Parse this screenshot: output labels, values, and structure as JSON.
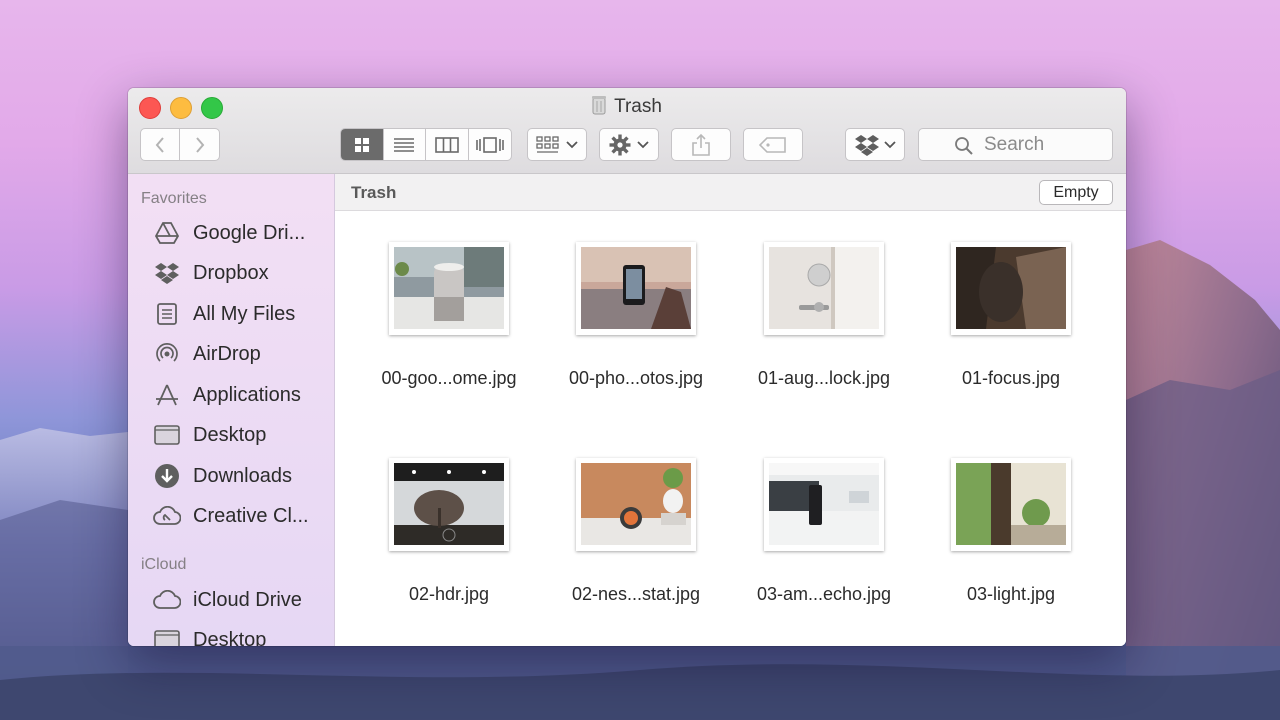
{
  "window": {
    "title": "Trash"
  },
  "toolbar": {
    "back_icon": "chevron-left-icon",
    "forward_icon": "chevron-right-icon",
    "view_modes": [
      "icon-view",
      "list-view",
      "column-view",
      "cover-flow-view"
    ],
    "active_view": "icon-view",
    "arrange_icon": "arrange-grid-icon",
    "action_icon": "gear-icon",
    "share_icon": "share-icon",
    "tag_icon": "tag-icon",
    "dropbox_icon": "dropbox-icon",
    "search_placeholder": "Search"
  },
  "sidebar": {
    "favorites_header": "Favorites",
    "items": [
      {
        "label": "Google Dri...",
        "icon": "google-drive-icon"
      },
      {
        "label": "Dropbox",
        "icon": "dropbox-icon"
      },
      {
        "label": "All My Files",
        "icon": "all-files-icon"
      },
      {
        "label": "AirDrop",
        "icon": "airdrop-icon"
      },
      {
        "label": "Applications",
        "icon": "applications-icon"
      },
      {
        "label": "Desktop",
        "icon": "desktop-icon"
      },
      {
        "label": "Downloads",
        "icon": "downloads-icon"
      },
      {
        "label": "Creative Cl...",
        "icon": "creative-cloud-icon"
      }
    ],
    "icloud_header": "iCloud",
    "icloud_items": [
      {
        "label": "iCloud Drive",
        "icon": "cloud-icon"
      },
      {
        "label": "Desktop",
        "icon": "desktop-icon"
      }
    ]
  },
  "main": {
    "path_title": "Trash",
    "empty_label": "Empty",
    "files": [
      {
        "name": "00-goo...ome.jpg"
      },
      {
        "name": "00-pho...otos.jpg"
      },
      {
        "name": "01-aug...lock.jpg"
      },
      {
        "name": "01-focus.jpg"
      },
      {
        "name": "02-hdr.jpg"
      },
      {
        "name": "02-nes...stat.jpg"
      },
      {
        "name": "03-am...echo.jpg"
      },
      {
        "name": "03-light.jpg"
      }
    ]
  },
  "colors": {
    "close": "#fc5753",
    "minimize": "#fdbc40",
    "maximize": "#33c748",
    "active_segment": "#6b6b6b"
  }
}
